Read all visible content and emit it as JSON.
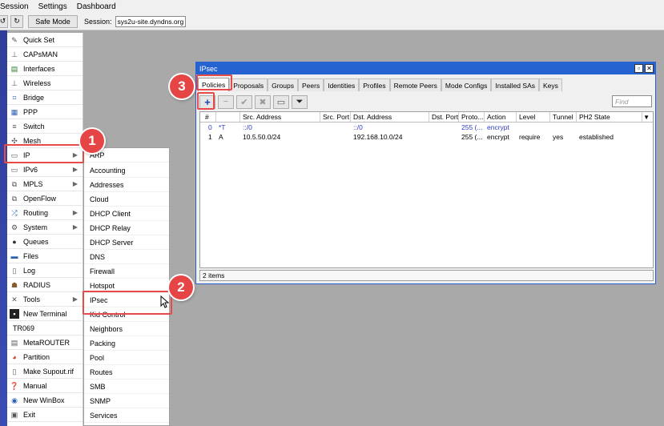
{
  "menubar": {
    "items": [
      "Session",
      "Settings",
      "Dashboard"
    ]
  },
  "toolbar": {
    "undo_icon": "undo-icon",
    "redo_icon": "redo-icon",
    "safe_mode_label": "Safe Mode",
    "session_label": "Session:",
    "session_value": "sys2u-site.dyndns.org"
  },
  "sidebar": {
    "items": [
      {
        "label": "Quick Set",
        "icon": "quick-set-icon"
      },
      {
        "label": "CAPsMAN",
        "icon": "capsman-icon"
      },
      {
        "label": "Interfaces",
        "icon": "interfaces-icon"
      },
      {
        "label": "Wireless",
        "icon": "wireless-icon"
      },
      {
        "label": "Bridge",
        "icon": "bridge-icon"
      },
      {
        "label": "PPP",
        "icon": "ppp-icon"
      },
      {
        "label": "Switch",
        "icon": "switch-icon"
      },
      {
        "label": "Mesh",
        "icon": "mesh-icon"
      },
      {
        "label": "IP",
        "icon": "ip-icon",
        "arrow": true
      },
      {
        "label": "IPv6",
        "icon": "ipv6-icon",
        "arrow": true
      },
      {
        "label": "MPLS",
        "icon": "mpls-icon",
        "arrow": true
      },
      {
        "label": "OpenFlow",
        "icon": "openflow-icon"
      },
      {
        "label": "Routing",
        "icon": "routing-icon",
        "arrow": true
      },
      {
        "label": "System",
        "icon": "system-icon",
        "arrow": true
      },
      {
        "label": "Queues",
        "icon": "queues-icon"
      },
      {
        "label": "Files",
        "icon": "files-icon"
      },
      {
        "label": "Log",
        "icon": "log-icon"
      },
      {
        "label": "RADIUS",
        "icon": "radius-icon"
      },
      {
        "label": "Tools",
        "icon": "tools-icon",
        "arrow": true
      },
      {
        "label": "New Terminal",
        "icon": "terminal-icon"
      },
      {
        "label": "TR069",
        "icon": ""
      },
      {
        "label": "MetaROUTER",
        "icon": "metarouter-icon"
      },
      {
        "label": "Partition",
        "icon": "partition-icon"
      },
      {
        "label": "Make Supout.rif",
        "icon": "supout-icon"
      },
      {
        "label": "Manual",
        "icon": "manual-icon"
      },
      {
        "label": "New WinBox",
        "icon": "winbox-icon"
      },
      {
        "label": "Exit",
        "icon": "exit-icon"
      }
    ]
  },
  "ip_submenu": {
    "items": [
      "ARP",
      "Accounting",
      "Addresses",
      "Cloud",
      "DHCP Client",
      "DHCP Relay",
      "DHCP Server",
      "DNS",
      "Firewall",
      "Hotspot",
      "IPsec",
      "Kid Control",
      "Neighbors",
      "Packing",
      "Pool",
      "Routes",
      "SMB",
      "SNMP",
      "Services"
    ]
  },
  "ipsec_window": {
    "title": "IPsec",
    "tabs": [
      "Policies",
      "Proposals",
      "Groups",
      "Peers",
      "Identities",
      "Profiles",
      "Remote Peers",
      "Mode Configs",
      "Installed SAs",
      "Keys"
    ],
    "active_tab": "Policies",
    "find_placeholder": "Find",
    "columns": [
      "#",
      "",
      "Src. Address",
      "Src. Port",
      "Dst. Address",
      "Dst. Port",
      "Proto...",
      "Action",
      "Level",
      "Tunnel",
      "PH2 State"
    ],
    "rows": [
      [
        "0",
        "*T",
        "::/0",
        "",
        "::/0",
        "",
        "255 (...",
        "encrypt",
        "",
        "",
        ""
      ],
      [
        "1",
        "A",
        "10.5.50.0/24",
        "",
        "192.168.10.0/24",
        "",
        "255 (...",
        "encrypt",
        "require",
        "yes",
        "established"
      ]
    ],
    "status": "2 items"
  },
  "annotations": {
    "step1": "1",
    "step2": "2",
    "step3": "3"
  },
  "colors": {
    "highlight": "#e84a4a",
    "title_bar": "#2563d1",
    "dynamic_row": "#2d3dbf"
  }
}
